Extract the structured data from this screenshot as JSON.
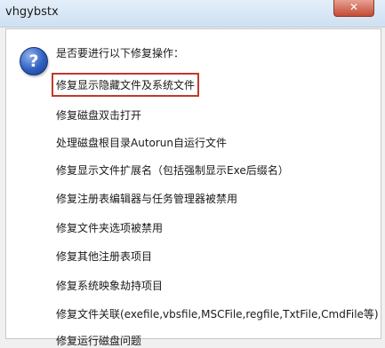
{
  "window": {
    "title": "vhgybstx",
    "close_label": "✕"
  },
  "dialog": {
    "question": "是否要进行以下修复操作：",
    "options": [
      "修复显示隐藏文件及系统文件",
      "修复磁盘双击打开",
      "处理磁盘根目录Autorun自运行文件",
      "修复显示文件扩展名（包括强制显示Exe后缀名）",
      "修复注册表编辑器与任务管理器被禁用",
      "修复文件夹选项被禁用",
      "修复其他注册表项目",
      "修复系统映象劫持项目",
      "修复文件关联(exefile,vbsfile,MSCFile,regfile,TxtFile,CmdFile等)",
      "修复运行磁盘问题"
    ]
  },
  "colors": {
    "highlight_border": "#c0392b",
    "title_gradient": "#cfe0f2"
  },
  "icons": {
    "question": "question-icon",
    "close": "close-icon"
  }
}
